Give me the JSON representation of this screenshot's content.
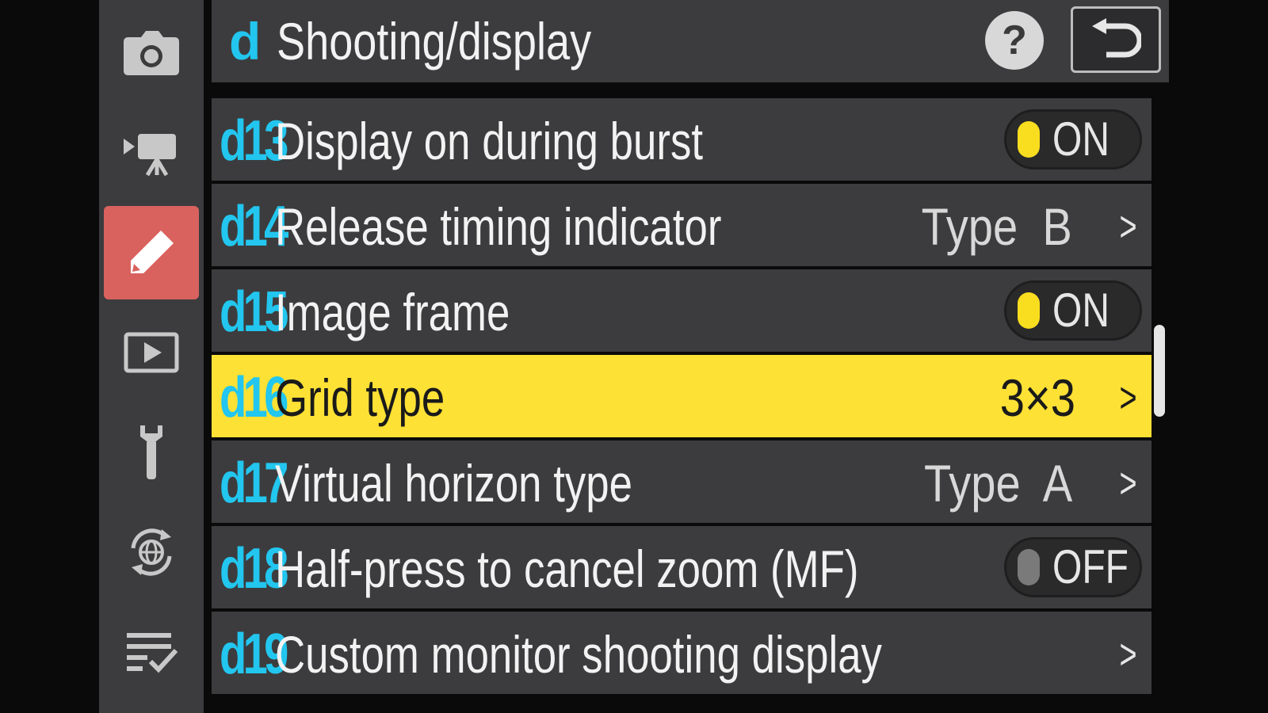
{
  "header": {
    "section_letter": "d",
    "title": "Shooting/display",
    "help_label": "?"
  },
  "tabs": [
    {
      "name": "photo-shooting-menu",
      "icon": "camera-icon"
    },
    {
      "name": "video-recording-menu",
      "icon": "video-camera-icon"
    },
    {
      "name": "custom-settings-menu",
      "icon": "pencil-icon",
      "active": true
    },
    {
      "name": "playback-menu",
      "icon": "playback-icon"
    },
    {
      "name": "setup-menu",
      "icon": "wrench-icon"
    },
    {
      "name": "network-menu",
      "icon": "globe-network-icon"
    },
    {
      "name": "my-menu",
      "icon": "checklist-icon"
    }
  ],
  "menu": {
    "rows": [
      {
        "code": "d13",
        "label": "Display on during burst",
        "toggle": "ON"
      },
      {
        "code": "d14",
        "label": "Release timing indicator",
        "value": "Type  B",
        "arrow": ">"
      },
      {
        "code": "d15",
        "label": "Image frame",
        "toggle": "ON"
      },
      {
        "code": "d16",
        "label": "Grid type",
        "value": "3×3",
        "arrow": ">",
        "selected": true
      },
      {
        "code": "d17",
        "label": "Virtual horizon type",
        "value": "Type  A",
        "arrow": ">"
      },
      {
        "code": "d18",
        "label": "Half-press to cancel zoom (MF)",
        "toggle": "OFF"
      },
      {
        "code": "d19",
        "label": "Custom monitor shooting display",
        "arrow": ">"
      }
    ]
  },
  "colors": {
    "accent_cyan": "#22c6ee",
    "selected_row": "#fde135",
    "active_tab": "#d9625f",
    "panel_bg": "#3c3c3e"
  }
}
